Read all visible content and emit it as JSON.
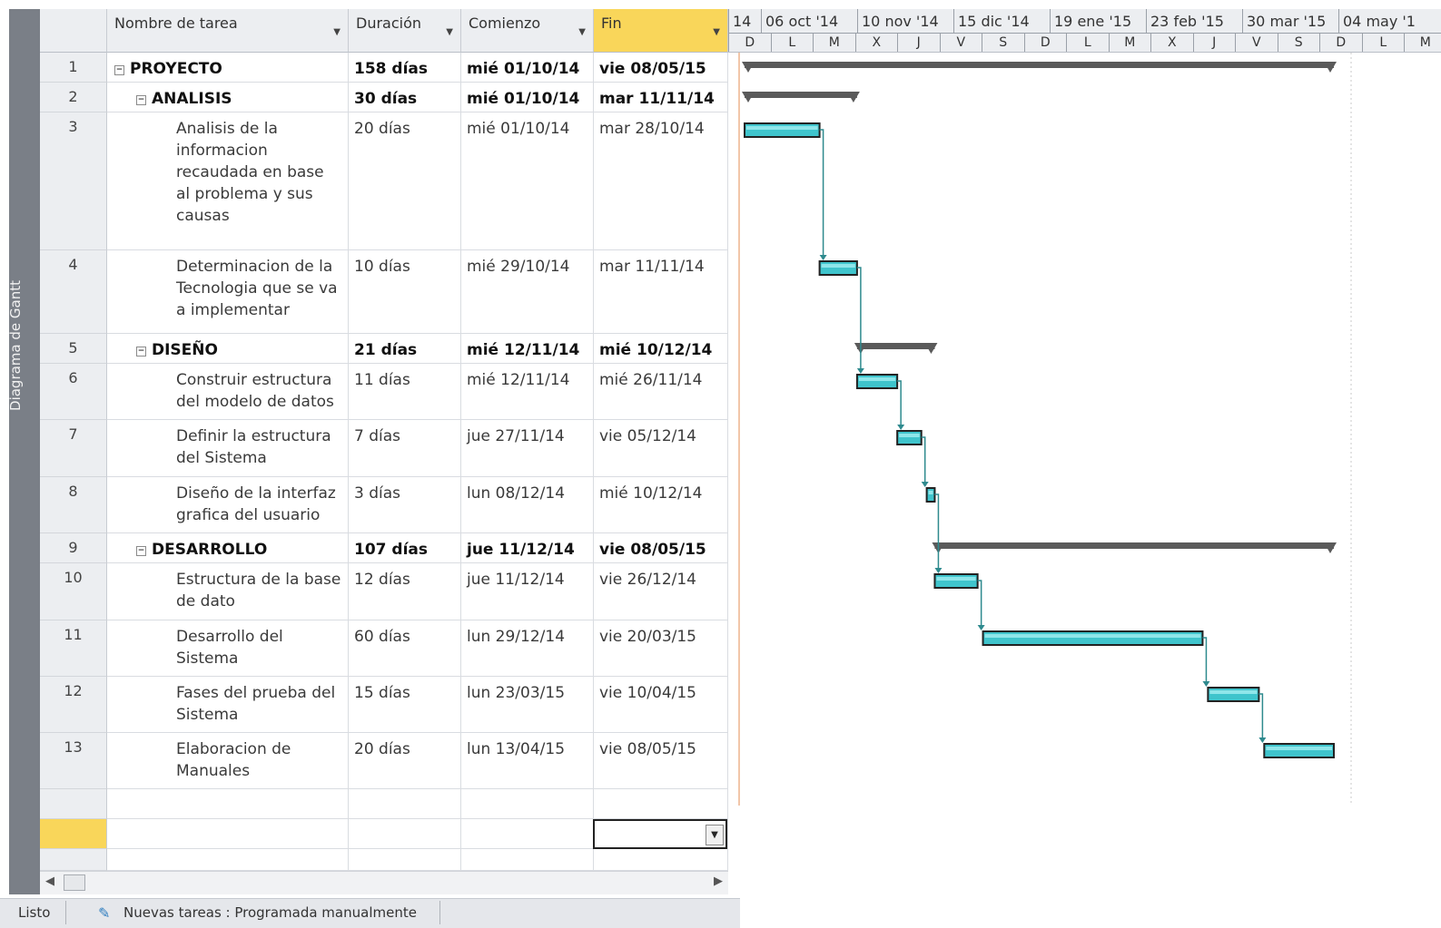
{
  "view_bar": {
    "label": "Diagrama de Gantt"
  },
  "columns": {
    "name": "Nombre de tarea",
    "duration": "Duración",
    "start": "Comienzo",
    "finish": "Fin"
  },
  "timeline": {
    "top": [
      "14",
      "06 oct '14",
      "10 nov '14",
      "15 dic '14",
      "19 ene '15",
      "23 feb '15",
      "30 mar '15",
      "04 may '1"
    ],
    "bottom": [
      "D",
      "L",
      "M",
      "X",
      "J",
      "V",
      "S",
      "D",
      "L",
      "M",
      "X",
      "J",
      "V",
      "S",
      "D",
      "L",
      "M"
    ]
  },
  "tasks": [
    {
      "id": "1",
      "name": "PROYECTO",
      "duration": "158 días",
      "start": "mié 01/10/14",
      "finish": "vie 08/05/15",
      "level": 0,
      "summary": true
    },
    {
      "id": "2",
      "name": "ANALISIS",
      "duration": "30 días",
      "start": "mié 01/10/14",
      "finish": "mar 11/11/14",
      "level": 1,
      "summary": true
    },
    {
      "id": "3",
      "name": "Analisis de la informacion recaudada en base al problema y sus causas",
      "duration": "20 días",
      "start": "mié 01/10/14",
      "finish": "mar 28/10/14",
      "level": 2,
      "summary": false
    },
    {
      "id": "4",
      "name": "Determinacion de la Tecnologia que se va a implementar",
      "duration": "10 días",
      "start": "mié 29/10/14",
      "finish": "mar 11/11/14",
      "level": 2,
      "summary": false
    },
    {
      "id": "5",
      "name": "DISEÑO",
      "duration": "21 días",
      "start": "mié 12/11/14",
      "finish": "mié 10/12/14",
      "level": 1,
      "summary": true
    },
    {
      "id": "6",
      "name": "Construir estructura del modelo de datos",
      "duration": "11 días",
      "start": "mié 12/11/14",
      "finish": "mié 26/11/14",
      "level": 2,
      "summary": false
    },
    {
      "id": "7",
      "name": "Definir la estructura del Sistema",
      "duration": "7 días",
      "start": "jue 27/11/14",
      "finish": "vie 05/12/14",
      "level": 2,
      "summary": false
    },
    {
      "id": "8",
      "name": "Diseño de la interfaz grafica del usuario",
      "duration": "3 días",
      "start": "lun 08/12/14",
      "finish": "mié 10/12/14",
      "level": 2,
      "summary": false
    },
    {
      "id": "9",
      "name": "DESARROLLO",
      "duration": "107 días",
      "start": "jue 11/12/14",
      "finish": "vie 08/05/15",
      "level": 1,
      "summary": true
    },
    {
      "id": "10",
      "name": "Estructura de la base de dato",
      "duration": "12 días",
      "start": "jue 11/12/14",
      "finish": "vie 26/12/14",
      "level": 2,
      "summary": false
    },
    {
      "id": "11",
      "name": "Desarrollo del Sistema",
      "duration": "60 días",
      "start": "lun 29/12/14",
      "finish": "vie 20/03/15",
      "level": 2,
      "summary": false
    },
    {
      "id": "12",
      "name": "Fases del prueba del Sistema",
      "duration": "15 días",
      "start": "lun 23/03/15",
      "finish": "vie 10/04/15",
      "level": 2,
      "summary": false
    },
    {
      "id": "13",
      "name": "Elaboracion de Manuales",
      "duration": "20 días",
      "start": "lun 13/04/15",
      "finish": "vie 08/05/15",
      "level": 2,
      "summary": false
    }
  ],
  "status_bar": {
    "ready": "Listo",
    "new_tasks": "Nuevas tareas : Programada manualmente"
  },
  "colors": {
    "task_bar": "#3fc4cc",
    "summary_bar": "#5a5a5a",
    "link": "#2e8a8e",
    "header_active": "#f9d65a"
  }
}
